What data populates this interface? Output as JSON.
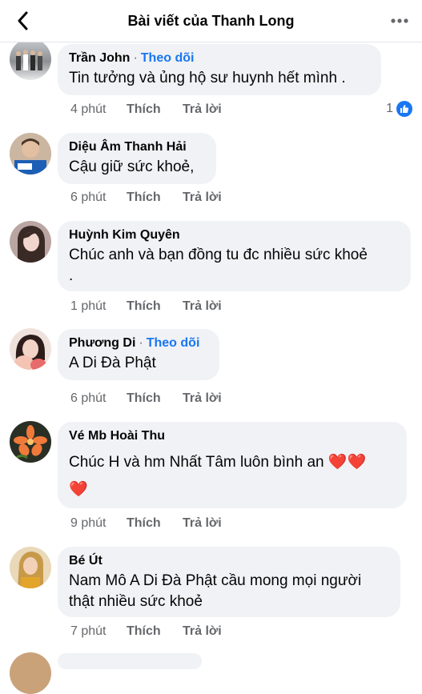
{
  "header": {
    "title": "Bài viết của Thanh Long"
  },
  "comments": [
    {
      "author": "Trần John",
      "follow": "Theo dõi",
      "text": "Tin tưởng và ủng hộ sư huynh hết mình .",
      "time": "4 phút",
      "like_label": "Thích",
      "reply_label": "Trả lời",
      "reaction_count": "1"
    },
    {
      "author": "Diệu Âm Thanh Hải",
      "text": "Cậu giữ sức khoẻ,",
      "time": "6 phút",
      "like_label": "Thích",
      "reply_label": "Trả lời"
    },
    {
      "author": "Huỳnh Kim Quyên",
      "text_line1": "Chúc anh và bạn đồng tu đc nhiều sức khoẻ",
      "text_line2": ".",
      "time": "1 phút",
      "like_label": "Thích",
      "reply_label": "Trả lời"
    },
    {
      "author": "Phương Di",
      "follow": "Theo dõi",
      "text": "A Di Đà Phật",
      "time": "6 phút",
      "like_label": "Thích",
      "reply_label": "Trả lời"
    },
    {
      "author": "Vé Mb Hoài Thu",
      "text_line1": "Chúc H và hm Nhất Tâm luôn bình an ❤️❤️",
      "text_line2": "❤️",
      "time": "9 phút",
      "like_label": "Thích",
      "reply_label": "Trả lời"
    },
    {
      "author": "Bé Út",
      "text_line1": "Nam Mô A Di Đà Phật cầu mong mọi người",
      "text_line2": "thật nhiều sức khoẻ",
      "time": "7 phút",
      "like_label": "Thích",
      "reply_label": "Trả lời"
    }
  ],
  "icons": {
    "back": "chevron-left-icon",
    "more": "more-horizontal-icon",
    "like_reaction": "thumbs-up-icon"
  },
  "colors": {
    "accent": "#1877f2",
    "bubble": "#f0f2f5",
    "muted": "#65676b"
  }
}
